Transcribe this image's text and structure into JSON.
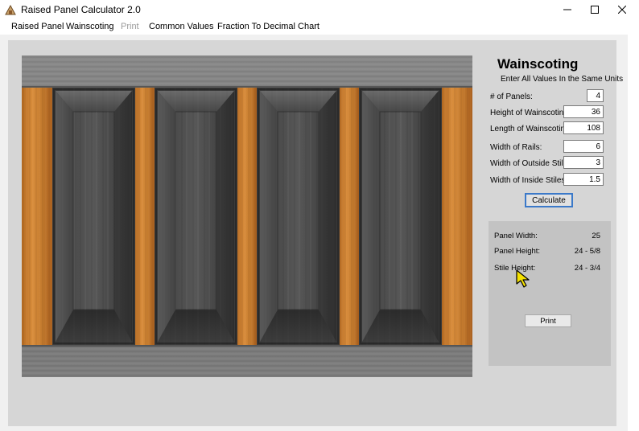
{
  "window": {
    "title": "Raised Panel Calculator 2.0",
    "icons": [
      "app-icon",
      "minimize-icon",
      "maximize-icon",
      "close-icon"
    ]
  },
  "menu": {
    "raised_panel": "Raised Panel",
    "wainscoting": "Wainscoting",
    "print": "Print",
    "common_values": "Common Values",
    "fraction_chart": "Fraction To Decimal Chart"
  },
  "form": {
    "title": "Wainscoting",
    "subtitle": "Enter All Values In the Same Units",
    "fields": [
      {
        "label": "# of Panels:",
        "value": "4"
      },
      {
        "label": "Height of Wainscoting:",
        "value": "36"
      },
      {
        "label": "Length of Wainscoting:",
        "value": "108"
      },
      {
        "label": "Width of Rails:",
        "value": "6"
      },
      {
        "label": "Width of Outside Stiles:",
        "value": "3"
      },
      {
        "label": "Width of Inside Stiles:",
        "value": "1.5"
      }
    ],
    "calculate_label": "Calculate"
  },
  "results": {
    "panel_width_label": "Panel Width:",
    "panel_width_value": "25",
    "panel_height_label": "Panel Height:",
    "panel_height_value": "24 - 5/8",
    "stile_height_label": "Stile Height:",
    "stile_height_value": "24 - 3/4",
    "print_label": "Print"
  },
  "colors": {
    "accent": "#3b79c9",
    "stile_wood": "#c87a2a",
    "panel_gray": "#4e4e4e",
    "cursor": "#f5e100"
  }
}
